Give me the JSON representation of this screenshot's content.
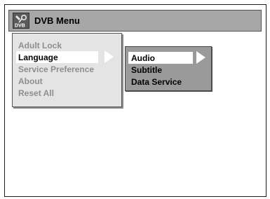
{
  "title": {
    "text": "DVB Menu",
    "icon": "dvb-settings-icon",
    "icon_label": "DVB"
  },
  "main_menu": {
    "items": [
      {
        "label": "Adult Lock",
        "active": false
      },
      {
        "label": "Language",
        "active": true
      },
      {
        "label": "Service Preference",
        "active": false
      },
      {
        "label": "About",
        "active": false
      },
      {
        "label": "Reset All",
        "active": false
      }
    ],
    "selected_index": 1
  },
  "sub_menu": {
    "items": [
      {
        "label": "Audio",
        "active": true
      },
      {
        "label": "Subtitle",
        "active": false
      },
      {
        "label": "Data Service",
        "active": false
      }
    ],
    "selected_index": 0
  },
  "colors": {
    "titlebar": "#a7a7a7",
    "main_menu_bg": "#e4e4e4",
    "sub_menu_bg": "#9a9a9a",
    "inactive_text": "#8e8e8e",
    "active_text": "#000000",
    "highlight": "#ffffff"
  }
}
